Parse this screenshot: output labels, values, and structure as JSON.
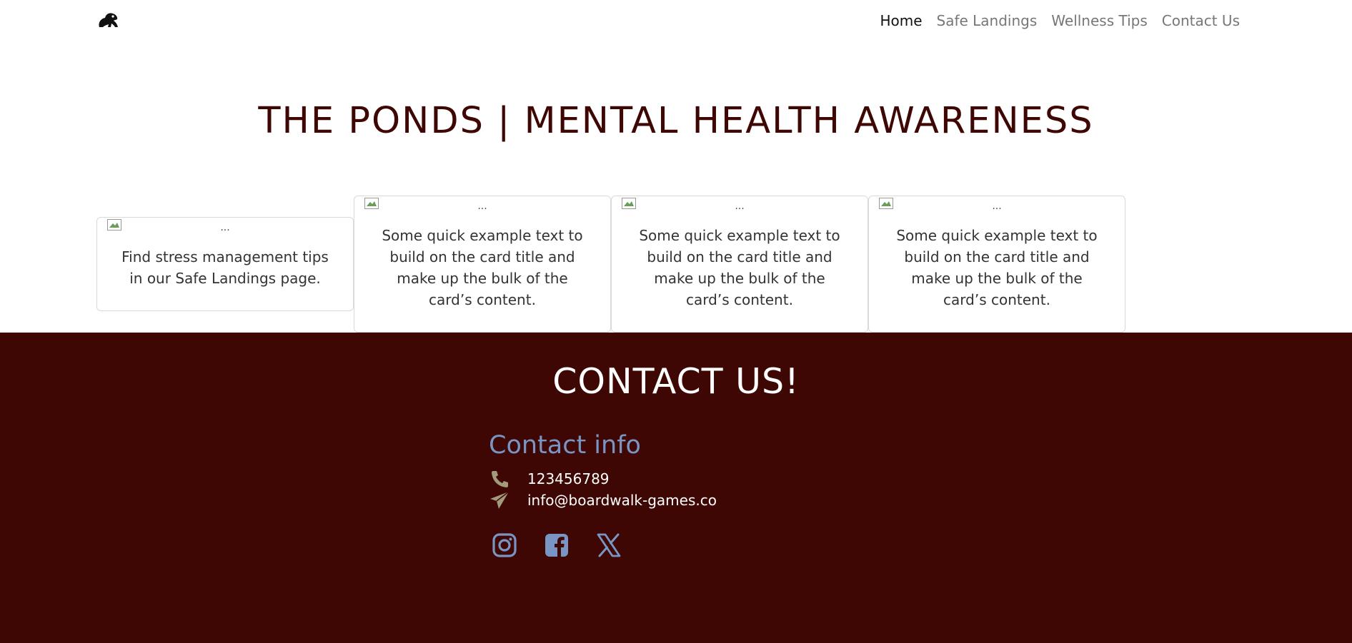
{
  "nav": {
    "logo_icon": "frog-icon",
    "links": [
      "Home",
      "Safe Landings",
      "Wellness Tips",
      "Contact Us"
    ],
    "active": "Home"
  },
  "page": {
    "title": "THE PONDS | MENTAL HEALTH AWARENESS"
  },
  "cards": [
    {
      "img_alt": "...",
      "text": "Find stress management tips in our Safe Landings page."
    },
    {
      "img_alt": "...",
      "text": "Some quick example text to build on the card title and make up the bulk of the card’s content."
    },
    {
      "img_alt": "...",
      "text": "Some quick example text to build on the card title and make up the bulk of the card’s content."
    },
    {
      "img_alt": "...",
      "text": "Some quick example text to build on the card title and make up the bulk of the card’s content."
    }
  ],
  "footer": {
    "title": "CONTACT US!",
    "contact_heading": "Contact info",
    "phone": "123456789",
    "email": "info@boardwalk-games.co",
    "phone_icon": "phone-icon",
    "email_icon": "paper-plane-icon",
    "social_icons": [
      "instagram-icon",
      "facebook-icon",
      "x-icon"
    ]
  },
  "colors": {
    "brand_dark": "#3f0704",
    "accent_blue": "#7a95c4",
    "icon_khaki": "#a39a7c"
  }
}
